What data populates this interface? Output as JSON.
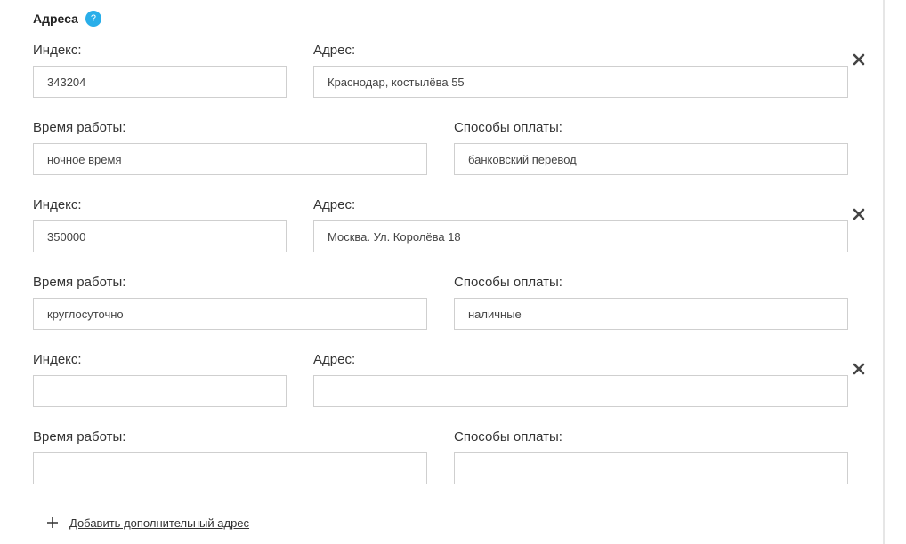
{
  "section": {
    "title": "Адреса",
    "help_icon": "?"
  },
  "labels": {
    "index": "Индекс:",
    "address": "Адрес:",
    "hours": "Время работы:",
    "payment": "Способы оплаты:"
  },
  "addresses": [
    {
      "index": "343204",
      "address": "Краснодар, костылёва 55",
      "hours": "ночное время",
      "payment": "банковский перевод"
    },
    {
      "index": "350000",
      "address": "Москва. Ул. Королёва 18",
      "hours": "круглосуточно",
      "payment": "наличные"
    },
    {
      "index": "",
      "address": "",
      "hours": "",
      "payment": ""
    }
  ],
  "add_address_label": "Добавить дополнительный адрес"
}
